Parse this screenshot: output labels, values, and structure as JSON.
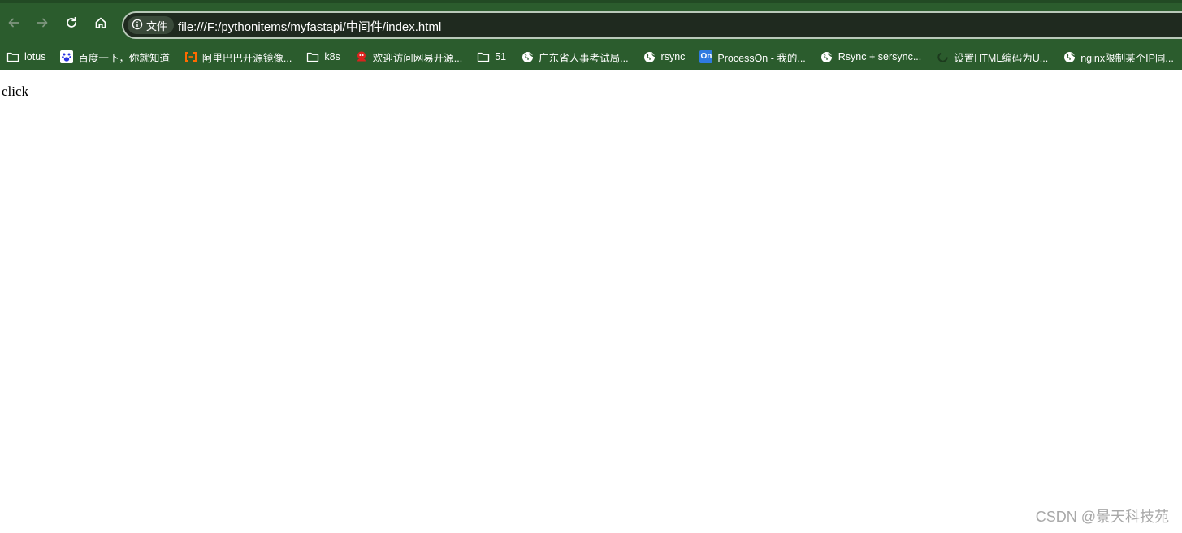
{
  "toolbar": {
    "back_icon": "arrow-left-icon",
    "forward_icon": "arrow-right-icon",
    "reload_icon": "reload-icon",
    "home_icon": "home-icon"
  },
  "omnibox": {
    "site_info_label": "文件",
    "url": "file:///F:/pythonitems/myfastapi/中间件/index.html"
  },
  "bookmarks": [
    {
      "label": "lotus",
      "icon": "folder-icon"
    },
    {
      "label": "百度一下，你就知道",
      "icon": "baidu-paw-icon"
    },
    {
      "label": "阿里巴巴开源镜像...",
      "icon": "alibaba-cloud-icon"
    },
    {
      "label": "k8s",
      "icon": "folder-icon"
    },
    {
      "label": "欢迎访问网易开源...",
      "icon": "netease-icon"
    },
    {
      "label": "51",
      "icon": "folder-icon"
    },
    {
      "label": "广东省人事考试局...",
      "icon": "globe-icon"
    },
    {
      "label": "rsync",
      "icon": "globe-icon"
    },
    {
      "label": "ProcessOn - 我的...",
      "icon": "processon-icon",
      "badge": "On"
    },
    {
      "label": "Rsync + sersync...",
      "icon": "globe-icon"
    },
    {
      "label": "设置HTML编码为U...",
      "icon": "spinner-icon"
    },
    {
      "label": "nginx限制某个IP同...",
      "icon": "globe-icon"
    }
  ],
  "page": {
    "body_text": "click"
  },
  "watermark": "CSDN @景天科技苑",
  "colors": {
    "chrome_bg": "#2b5c2d",
    "omnibox_bg": "#1f2a1f",
    "page_bg": "#ffffff"
  }
}
